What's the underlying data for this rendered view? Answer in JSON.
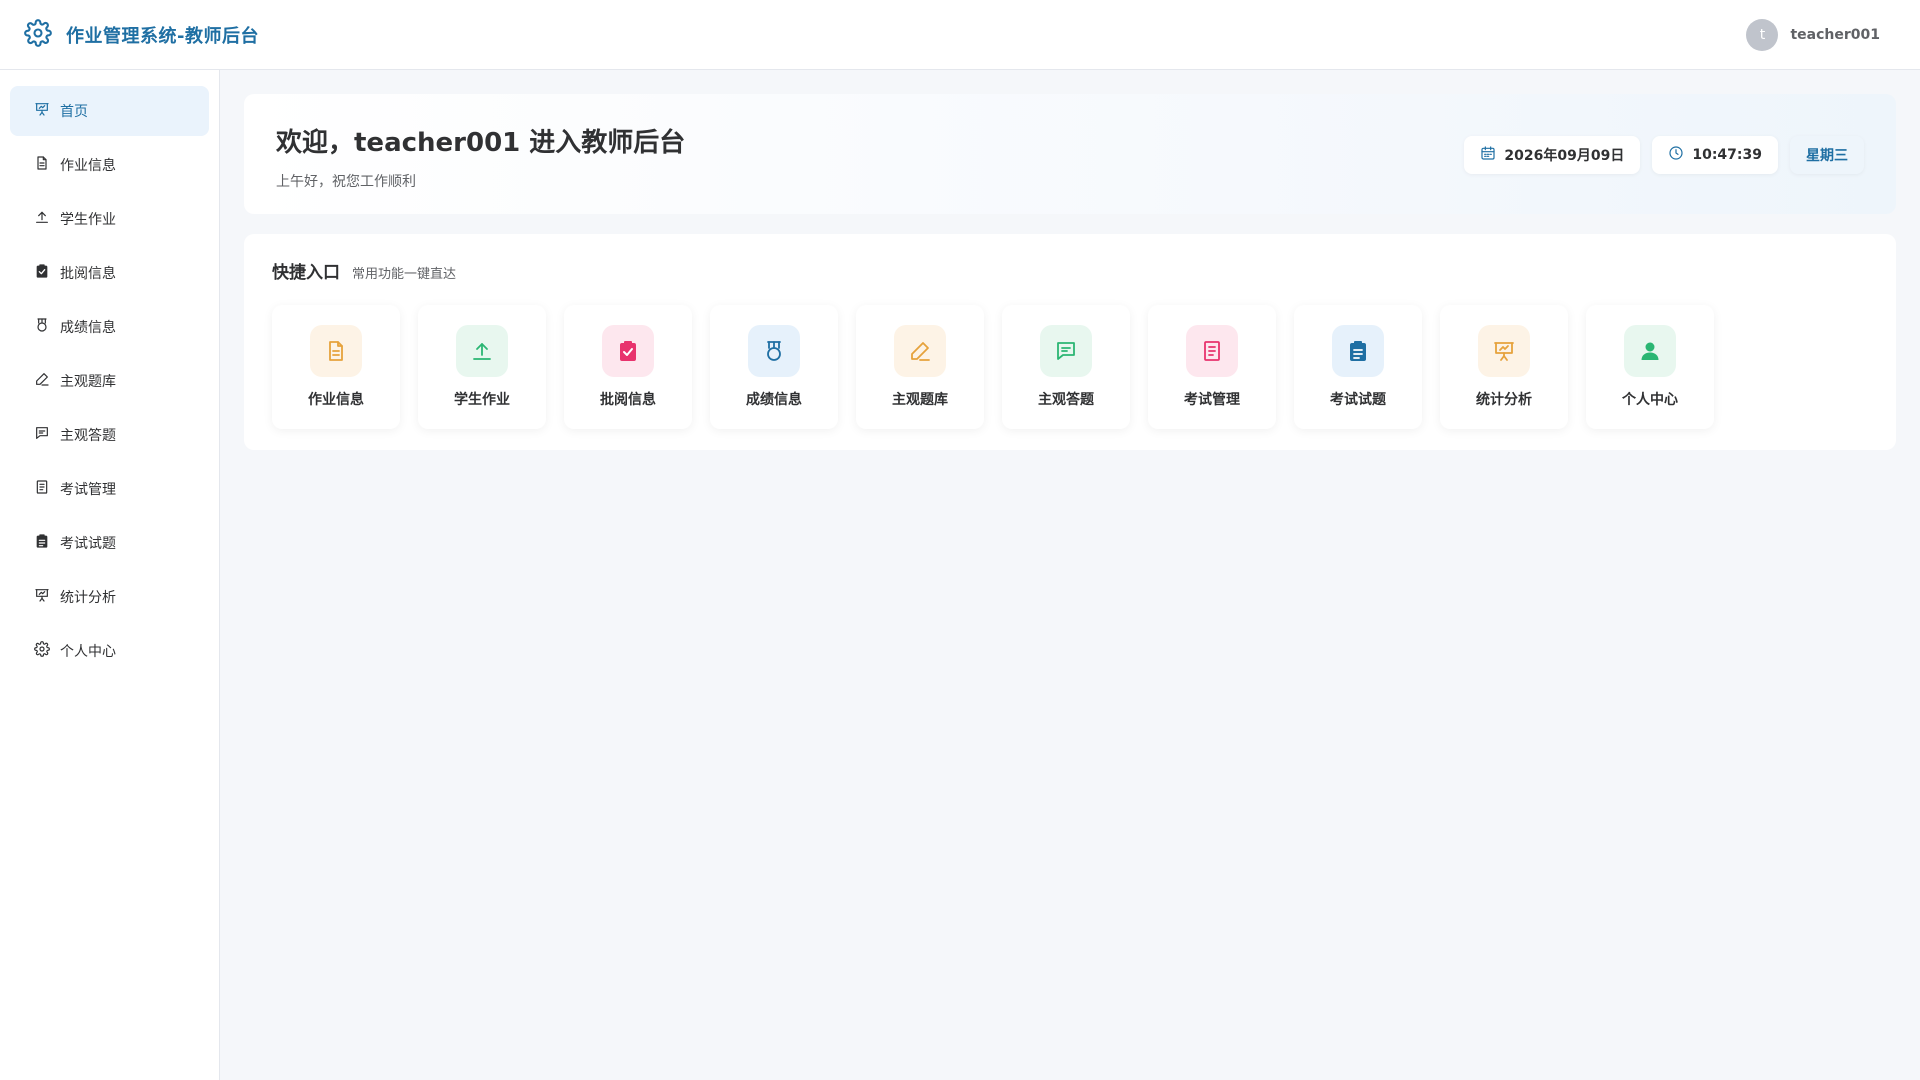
{
  "header": {
    "title": "作业管理系统-教师后台",
    "user": {
      "avatar_letter": "t",
      "name": "teacher001"
    }
  },
  "sidebar": {
    "items": [
      {
        "label": "首页",
        "icon": "presentation-icon",
        "active": true
      },
      {
        "label": "作业信息",
        "icon": "document-icon"
      },
      {
        "label": "学生作业",
        "icon": "upload-icon"
      },
      {
        "label": "批阅信息",
        "icon": "clipboard-check-icon"
      },
      {
        "label": "成绩信息",
        "icon": "medal-icon"
      },
      {
        "label": "主观题库",
        "icon": "edit-pen-icon"
      },
      {
        "label": "主观答题",
        "icon": "chat-icon"
      },
      {
        "label": "考试管理",
        "icon": "notebook-icon"
      },
      {
        "label": "考试试题",
        "icon": "clipboard-list-icon"
      },
      {
        "label": "统计分析",
        "icon": "chart-board-icon"
      },
      {
        "label": "个人中心",
        "icon": "gear-icon"
      }
    ]
  },
  "welcome": {
    "title": "欢迎，teacher001 进入教师后台",
    "subtitle": "上午好，祝您工作顺利",
    "date": "2026年09月09日",
    "time": "10:47:39",
    "weekday": "星期三"
  },
  "quick": {
    "title": "快捷入口",
    "subtitle": "常用功能一键直达",
    "items": [
      {
        "label": "作业信息",
        "icon": "document-icon",
        "color": "#e6a23c",
        "bg": "#fdf3e6"
      },
      {
        "label": "学生作业",
        "icon": "upload-icon",
        "color": "#2bb673",
        "bg": "#e8f7ef"
      },
      {
        "label": "批阅信息",
        "icon": "clipboard-check-icon",
        "color": "#e8336d",
        "bg": "#fde7ee"
      },
      {
        "label": "成绩信息",
        "icon": "medal-icon",
        "color": "#1f6fa3",
        "bg": "#e6f1fb"
      },
      {
        "label": "主观题库",
        "icon": "edit-pen-icon",
        "color": "#e6a23c",
        "bg": "#fdf3e6"
      },
      {
        "label": "主观答题",
        "icon": "chat-icon",
        "color": "#2bb673",
        "bg": "#e8f7ef"
      },
      {
        "label": "考试管理",
        "icon": "notebook-icon",
        "color": "#e8336d",
        "bg": "#fde7ee"
      },
      {
        "label": "考试试题",
        "icon": "clipboard-list-icon",
        "color": "#1f6fa3",
        "bg": "#e6f1fb"
      },
      {
        "label": "统计分析",
        "icon": "chart-board-icon",
        "color": "#e6a23c",
        "bg": "#fdf3e6"
      },
      {
        "label": "个人中心",
        "icon": "user-icon",
        "color": "#2bb673",
        "bg": "#e8f7ef"
      }
    ]
  },
  "colors": {
    "brand": "#1f6fa3",
    "active_bg": "#eaf3fc"
  }
}
